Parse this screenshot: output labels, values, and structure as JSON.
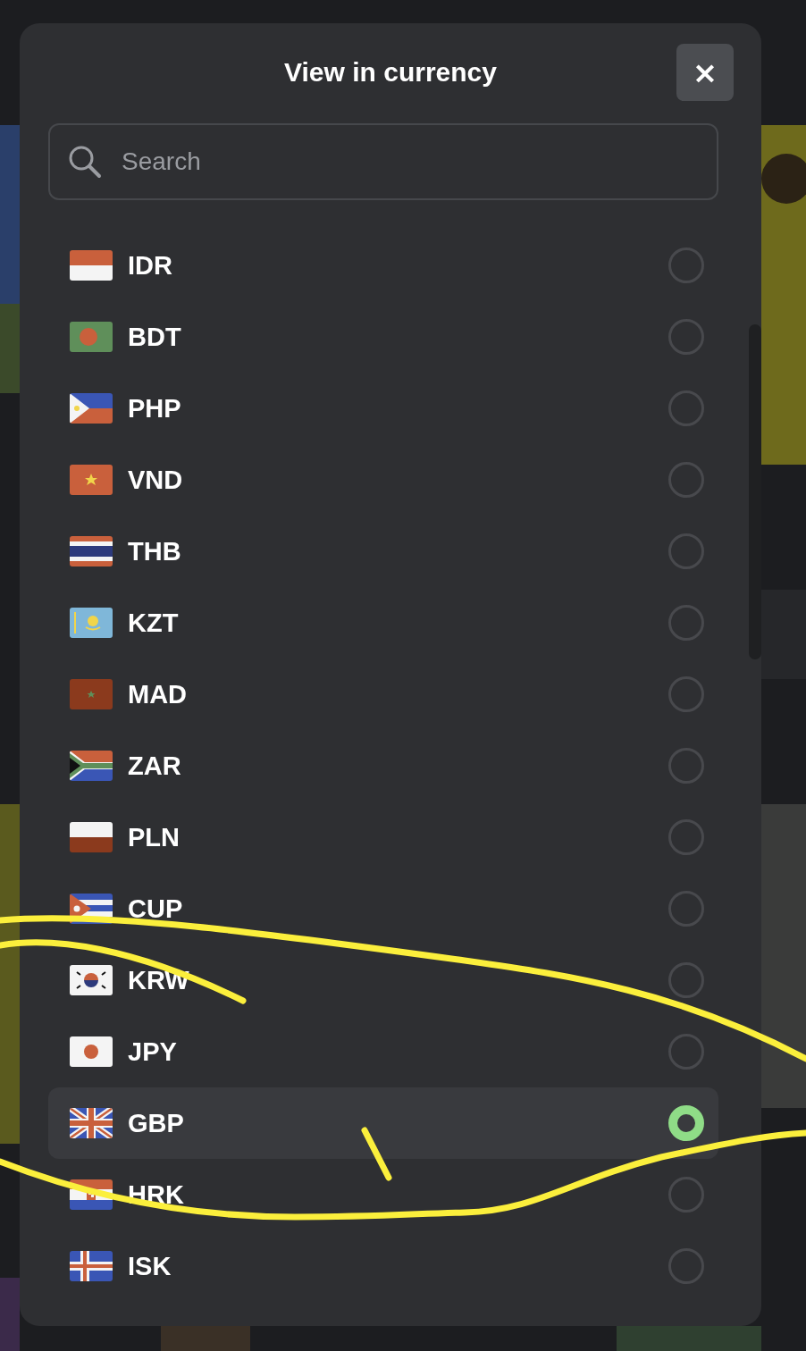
{
  "dialog": {
    "title": "View in currency",
    "close_label": "×"
  },
  "search": {
    "placeholder": "Search"
  },
  "currencies": [
    {
      "code": "IDR",
      "selected": false
    },
    {
      "code": "BDT",
      "selected": false
    },
    {
      "code": "PHP",
      "selected": false
    },
    {
      "code": "VND",
      "selected": false
    },
    {
      "code": "THB",
      "selected": false
    },
    {
      "code": "KZT",
      "selected": false
    },
    {
      "code": "MAD",
      "selected": false
    },
    {
      "code": "ZAR",
      "selected": false
    },
    {
      "code": "PLN",
      "selected": false
    },
    {
      "code": "CUP",
      "selected": false
    },
    {
      "code": "KRW",
      "selected": false
    },
    {
      "code": "JPY",
      "selected": false
    },
    {
      "code": "GBP",
      "selected": true
    },
    {
      "code": "HRK",
      "selected": false
    },
    {
      "code": "ISK",
      "selected": false
    }
  ]
}
